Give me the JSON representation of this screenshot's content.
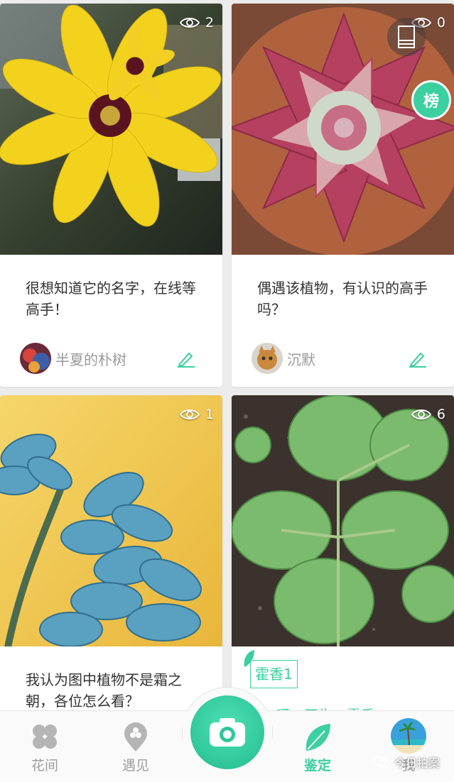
{
  "cards": [
    {
      "views": "2",
      "title": "很想知道它的名字，在线等高手！",
      "user": "半夏的朴树"
    },
    {
      "views": "0",
      "title": "偶遇该植物，有认识的高手吗？",
      "user": "沉默",
      "badge": "榜"
    },
    {
      "views": "1",
      "title": "我认为图中植物不是霜之朝，各位怎么看？"
    },
    {
      "views": "6",
      "tag": "霍香1",
      "desc": "鸡、呀…天生…霍香…"
    }
  ],
  "nav": {
    "items": [
      {
        "label": "花间",
        "icon": "clover-icon"
      },
      {
        "label": "遇见",
        "icon": "location-pin-icon"
      },
      {
        "label": "鉴定",
        "icon": "leaf-icon",
        "active": true
      },
      {
        "label": "我",
        "icon": "avatar"
      }
    ],
    "camera_icon": "camera-icon"
  },
  "watermark": "今日拍案",
  "colors": {
    "accent": "#3ccf9f",
    "background": "#ececec"
  }
}
